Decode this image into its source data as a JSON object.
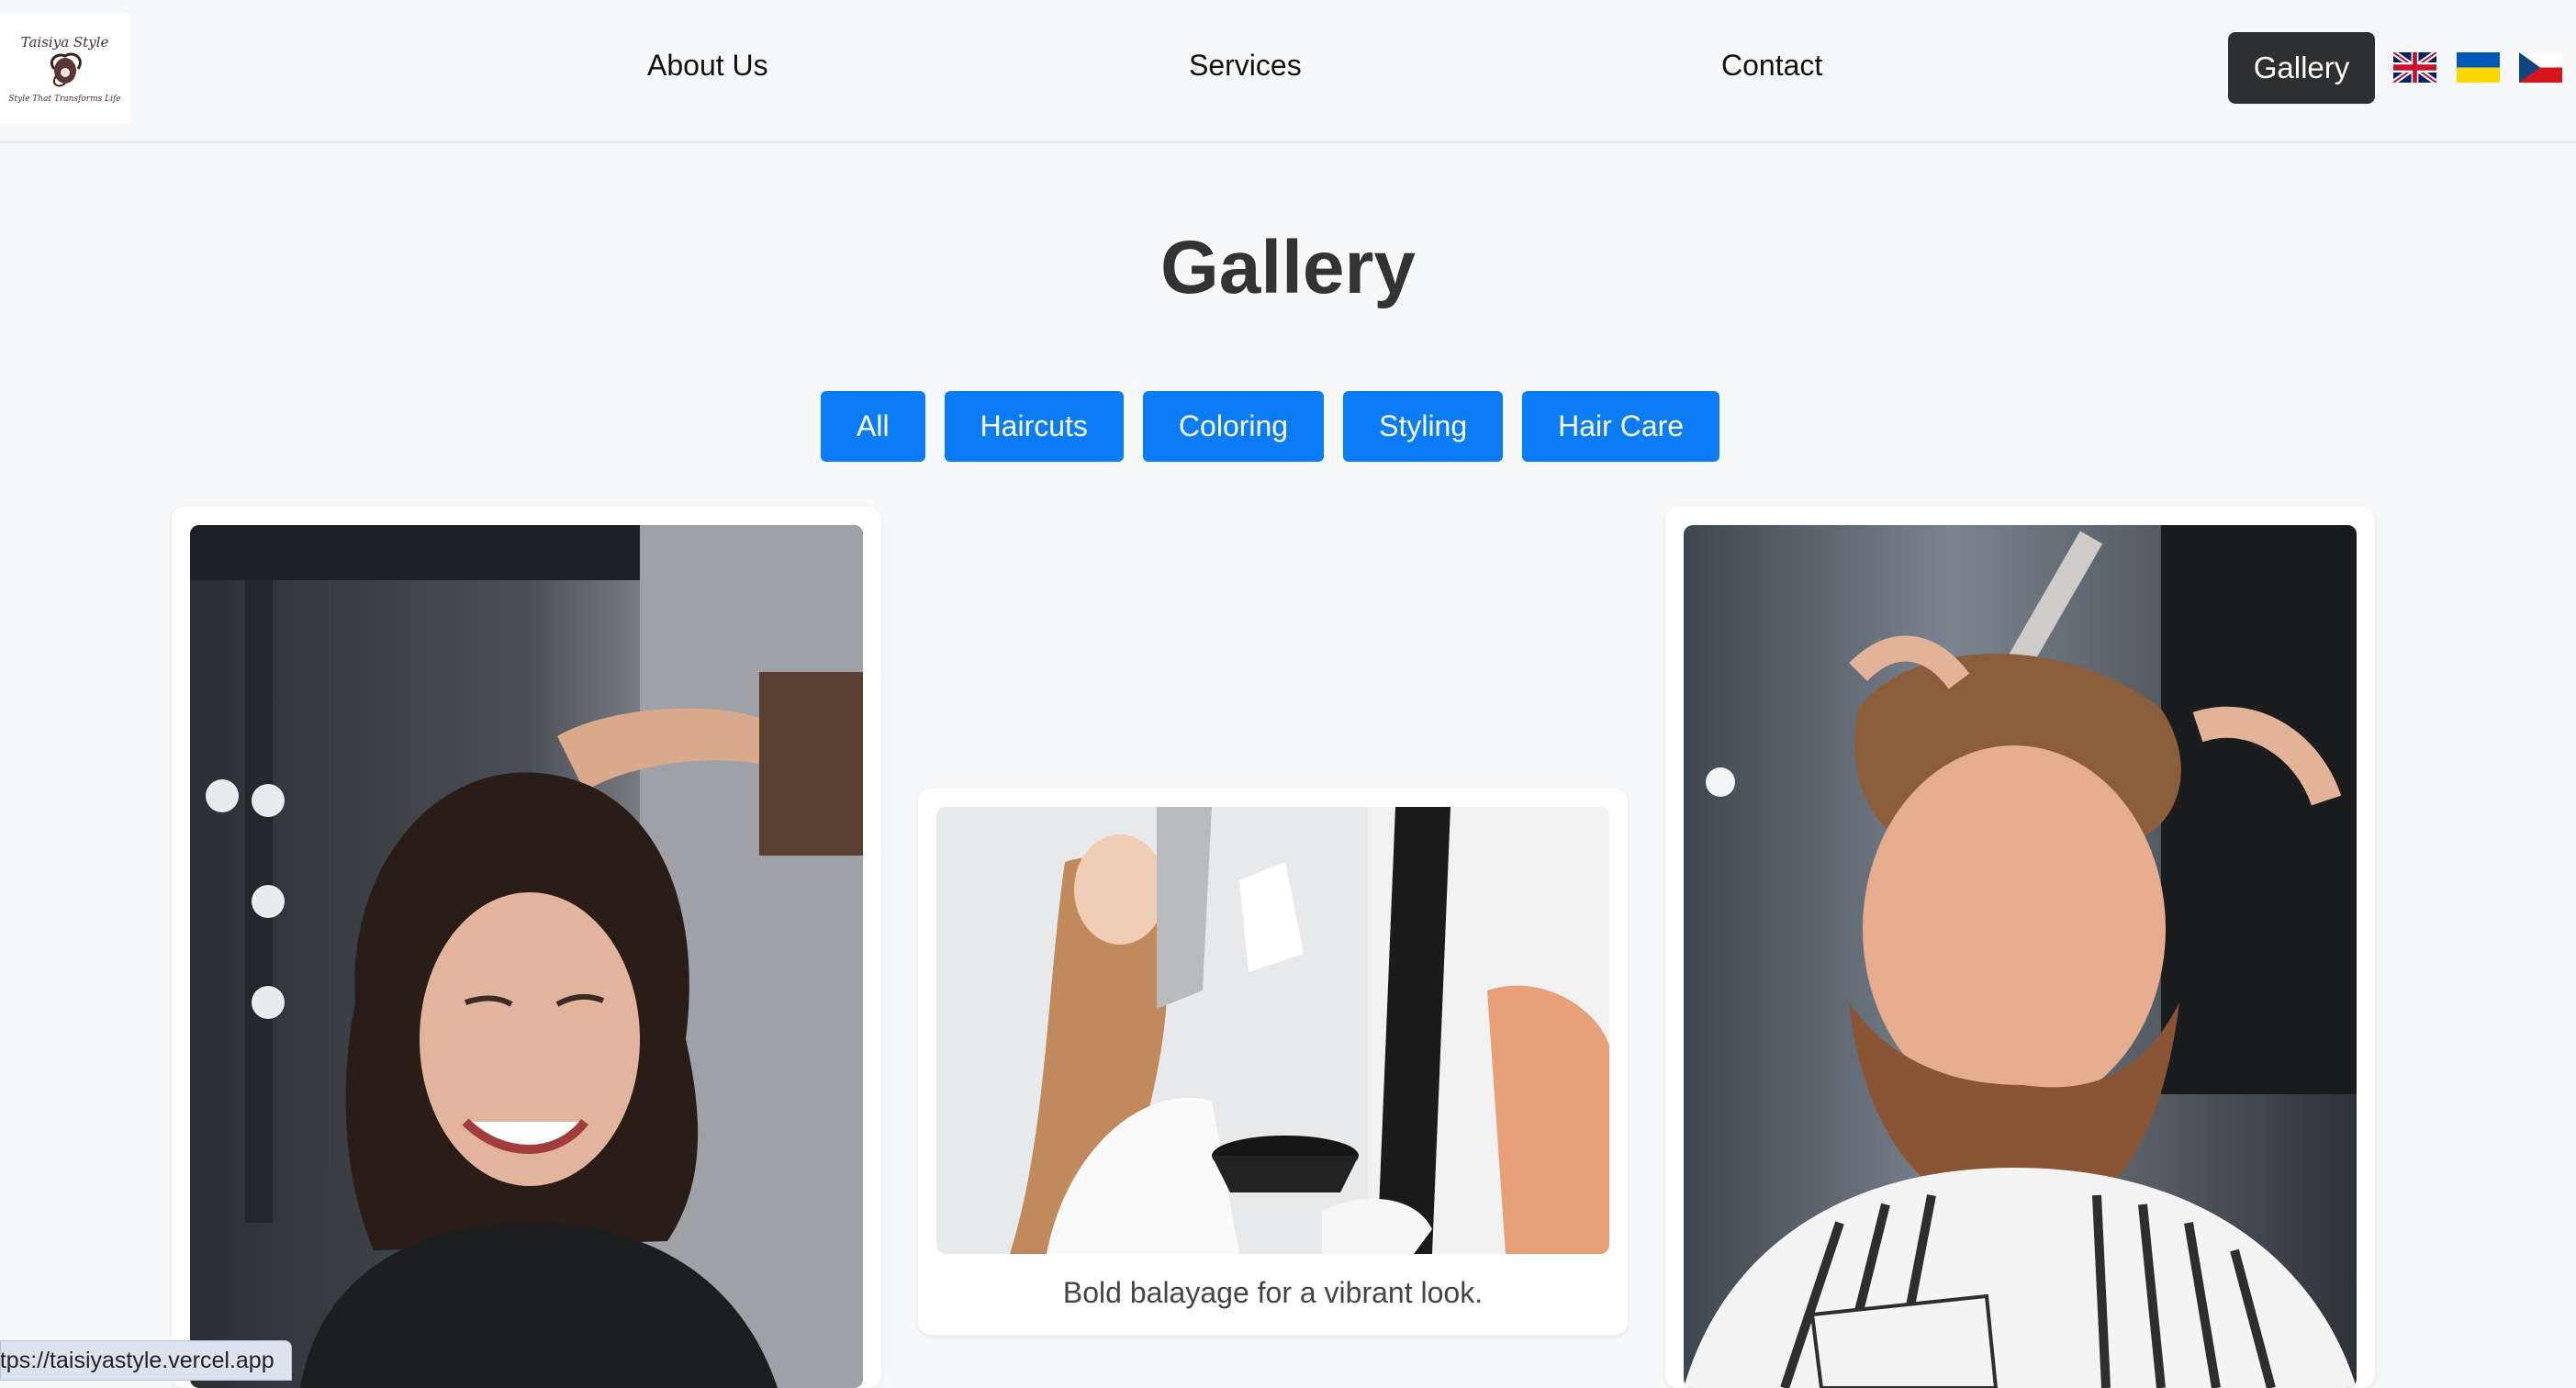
{
  "header": {
    "logo": {
      "script_text": "Taisiya Style",
      "tagline": "Style That Transforms Life"
    },
    "nav": [
      {
        "label": "About Us"
      },
      {
        "label": "Services"
      },
      {
        "label": "Contact"
      }
    ],
    "active_nav": {
      "label": "Gallery"
    },
    "languages": [
      {
        "icon": "uk-flag-icon"
      },
      {
        "icon": "ukraine-flag-icon"
      },
      {
        "icon": "czech-flag-icon"
      }
    ]
  },
  "main": {
    "title": "Gallery",
    "filters": [
      {
        "label": "All"
      },
      {
        "label": "Haircuts"
      },
      {
        "label": "Coloring"
      },
      {
        "label": "Styling"
      },
      {
        "label": "Hair Care"
      }
    ],
    "cards": [
      {
        "image": "woman-curly-hair-styling-photo",
        "caption": ""
      },
      {
        "image": "balayage-coloring-photo",
        "caption": "Bold balayage for a vibrant look."
      },
      {
        "image": "man-beard-barber-photo",
        "caption": ""
      }
    ]
  },
  "status_bar": {
    "url": "https://taisiyastyle.vercel.app"
  },
  "colors": {
    "accent": "#0a7cf5",
    "active_nav_bg": "#2d2f31",
    "page_bg": "#f7f8f9"
  }
}
